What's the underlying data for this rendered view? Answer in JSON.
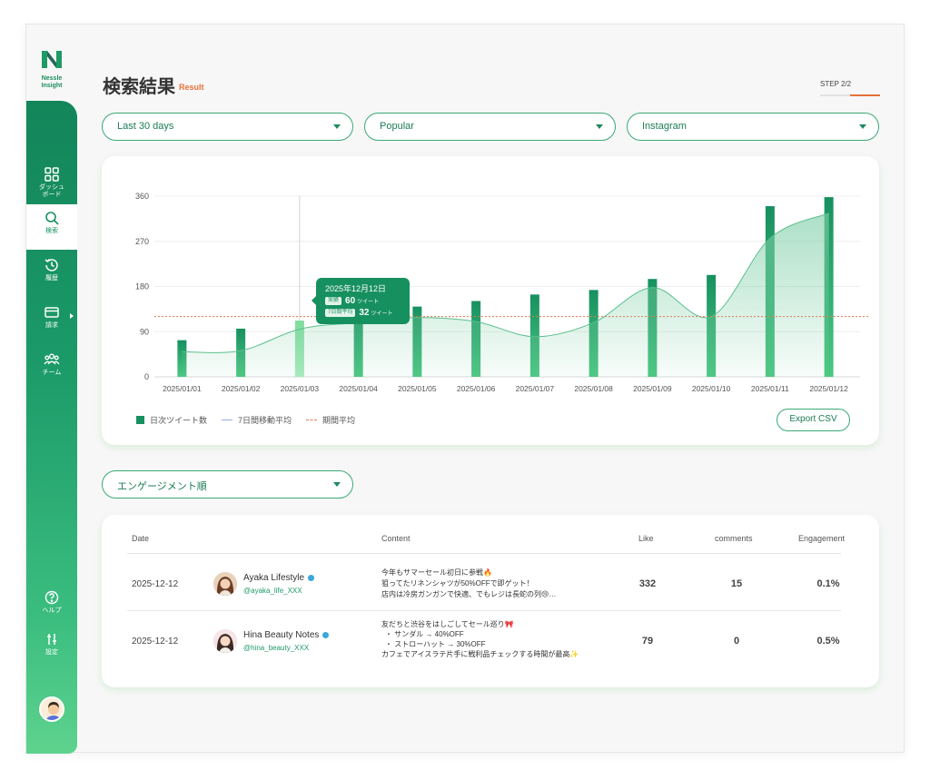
{
  "brand": {
    "line1": "Nessle",
    "line2": "Insight"
  },
  "nav": {
    "items": [
      {
        "label1": "ダッシュ",
        "label2": "ボード",
        "icon": "grid-icon"
      },
      {
        "label1": "検索",
        "label2": "",
        "icon": "search-icon"
      },
      {
        "label1": "履歴",
        "label2": "",
        "icon": "history-icon"
      },
      {
        "label1": "請求",
        "label2": "",
        "icon": "card-icon"
      },
      {
        "label1": "チーム",
        "label2": "",
        "icon": "team-icon"
      },
      {
        "label1": "ヘルプ",
        "label2": "",
        "icon": "help-icon"
      },
      {
        "label1": "設定",
        "label2": "",
        "icon": "settings-icon"
      }
    ]
  },
  "header": {
    "title": "検索結果",
    "subtitle": "Result",
    "step": "STEP 2/2",
    "step_progress": 0.5
  },
  "filters": {
    "period": "Last 30 days",
    "sort": "Popular",
    "platform": "Instagram"
  },
  "chart_data": {
    "type": "bar",
    "categories": [
      "2025/01/01",
      "2025/01/02",
      "2025/01/03",
      "2025/01/04",
      "2025/01/05",
      "2025/01/06",
      "2025/01/07",
      "2025/01/08",
      "2025/01/09",
      "2025/01/10",
      "2025/01/11",
      "2025/01/12"
    ],
    "series": [
      {
        "name": "日次ツイート数",
        "type": "bar",
        "values": [
          73,
          96,
          112,
          128,
          140,
          151,
          164,
          173,
          195,
          203,
          340,
          358
        ]
      },
      {
        "name": "7日間移動平均",
        "type": "area",
        "values": [
          50,
          52,
          95,
          108,
          118,
          110,
          80,
          108,
          178,
          120,
          276,
          326
        ]
      },
      {
        "name": "期間平均",
        "type": "line",
        "values": [
          120,
          120,
          120,
          120,
          120,
          120,
          120,
          120,
          120,
          120,
          120,
          120
        ]
      }
    ],
    "yticks": [
      0,
      90,
      180,
      270,
      360
    ],
    "ylim": [
      0,
      360
    ],
    "grid": true,
    "legend": "bottom-left",
    "highlight_index": 2,
    "colors": {
      "bar": "#17905f",
      "area": "#7fcfa8",
      "average": "#e07a50"
    }
  },
  "tooltip": {
    "date": "2025年12月12日",
    "actual_tag": "実績",
    "actual_value": "60",
    "actual_unit": "ツイート",
    "avg_tag": "7日間平均",
    "avg_value": "32",
    "avg_unit": "ツイート"
  },
  "export_label": "Export CSV",
  "sort_filter": "エンゲージメント順",
  "table": {
    "headers": {
      "date": "Date",
      "content": "Content",
      "like": "Like",
      "comments": "comments",
      "engagement": "Engagement"
    },
    "rows": [
      {
        "date": "2025-12-12",
        "name": "Ayaka Lifestyle",
        "handle": "@ayaka_life_XXX",
        "content": [
          "今年もサマーセール初日に参戦🔥",
          "狙ってたリネンシャツが50%OFFで即ゲット！",
          "店内は冷房ガンガンで快適、でもレジは長蛇の列😢…"
        ],
        "like": "332",
        "comments": "15",
        "engagement": "0.1%"
      },
      {
        "date": "2025-12-12",
        "name": "Hina Beauty Notes",
        "handle": "@hina_beauty_XXX",
        "content": [
          "友だちと渋谷をはしごしてセール巡り🎀",
          "・ サンダル → 40%OFF",
          "・ ストローハット → 30%OFF",
          "カフェでアイスラテ片手に戦利品チェックする時間が最高✨"
        ],
        "like": "79",
        "comments": "0",
        "engagement": "0.5%"
      }
    ]
  }
}
